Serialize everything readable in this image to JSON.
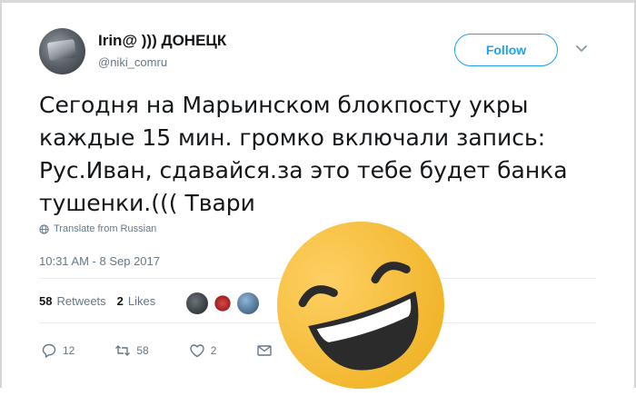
{
  "user": {
    "display_name": "Irin@ ))) ДОНЕЦК",
    "handle": "@niki_comru",
    "avatar_icon": "avatar-photo"
  },
  "header": {
    "follow_label": "Follow",
    "menu_icon": "chevron-down-icon"
  },
  "tweet": {
    "lines": [
      "Сегодня на Марьинском блокпосту укры",
      "каждые 15 мин. громко включали запись:",
      "Рус.Иван, сдавайся.за это тебе будет банка",
      "тушенки.((( Твари"
    ],
    "translate_label": "Translate from Russian",
    "timestamp": "10:31 AM - 8 Sep 2017"
  },
  "stats": {
    "retweets_count": "58",
    "retweets_label": "Retweets",
    "likes_count": "2",
    "likes_label": "Likes"
  },
  "actions": {
    "reply_count": "12",
    "retweet_count": "58",
    "like_count": "2"
  },
  "overlay": {
    "emoji": "rolling-on-the-floor-laughing-emoji"
  },
  "colors": {
    "accent": "#1da1f2",
    "text": "#14171a",
    "muted": "#657786",
    "emoji_yellow": "#fdc030"
  }
}
